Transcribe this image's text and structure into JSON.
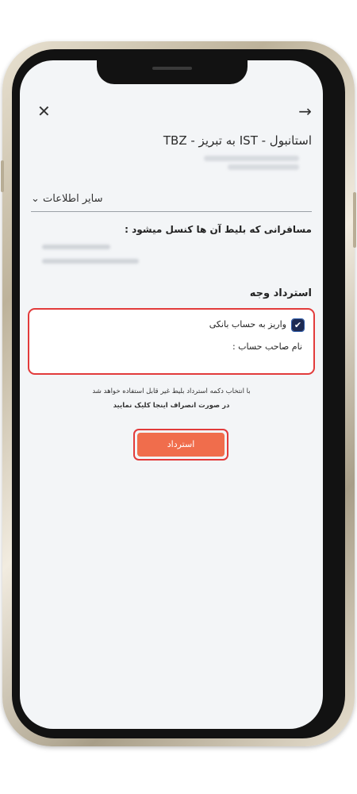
{
  "header": {
    "close_icon": "close-icon",
    "back_icon": "arrow-right-icon",
    "route_title": "استانبول - IST به تبریز - TBZ"
  },
  "more_info": {
    "label": "سایر اطلاعات",
    "icon": "chevron-down-icon"
  },
  "passengers": {
    "title": "مسافرانی که بلیط آن ها کنسل میشود :"
  },
  "refund": {
    "title": "استرداد وجه",
    "bank_deposit_label": "واریز به حساب بانکی",
    "bank_deposit_checked": true,
    "account_holder_label": "نام صاحب حساب :"
  },
  "notes": {
    "warning": "با انتخاب دکمه استرداد بلیط غیر قابل استفاده خواهد شد",
    "cancel_hint": "در صورت انصراف اینجا کلیک نمایید"
  },
  "actions": {
    "refund_button": "استرداد"
  },
  "colors": {
    "accent_button": "#f06d4c",
    "highlight_border": "#e23b3b",
    "checkbox_fill": "#1d2a52"
  }
}
